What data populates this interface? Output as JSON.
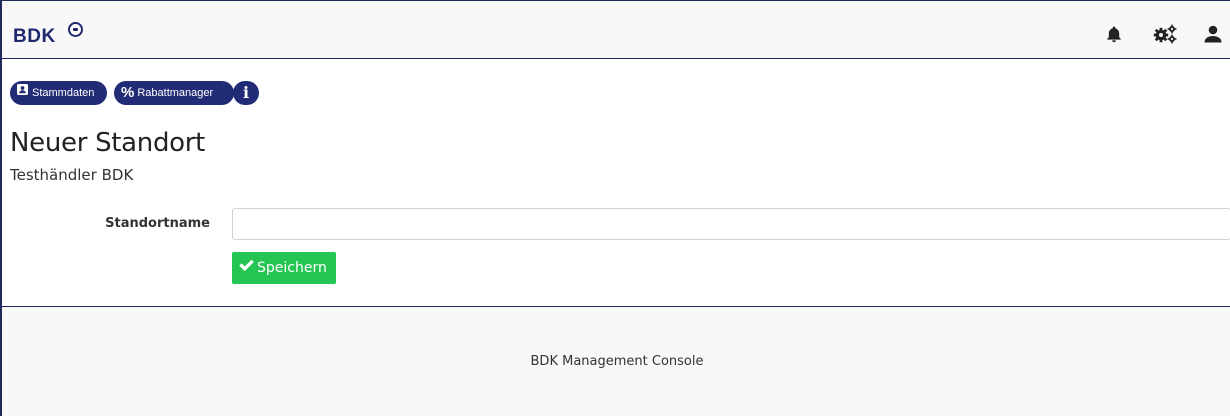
{
  "header": {
    "logo_text": "BDK",
    "icons": [
      "bell-icon",
      "gears-icon",
      "user-icon"
    ]
  },
  "actions": {
    "stammdaten_label": "Stammdaten",
    "rabattmanager_label": "Rabattmanager",
    "info_label": "i"
  },
  "page": {
    "title": "Neuer Standort",
    "subtitle": "Testhändler BDK"
  },
  "form": {
    "standortname_label": "Standortname",
    "standortname_value": "",
    "save_label": "Speichern"
  },
  "footer": {
    "text": "BDK Management Console"
  },
  "colors": {
    "brand": "#1f2a6e",
    "pill": "#222c76",
    "save": "#24c552",
    "border": "#1f2a5c"
  }
}
